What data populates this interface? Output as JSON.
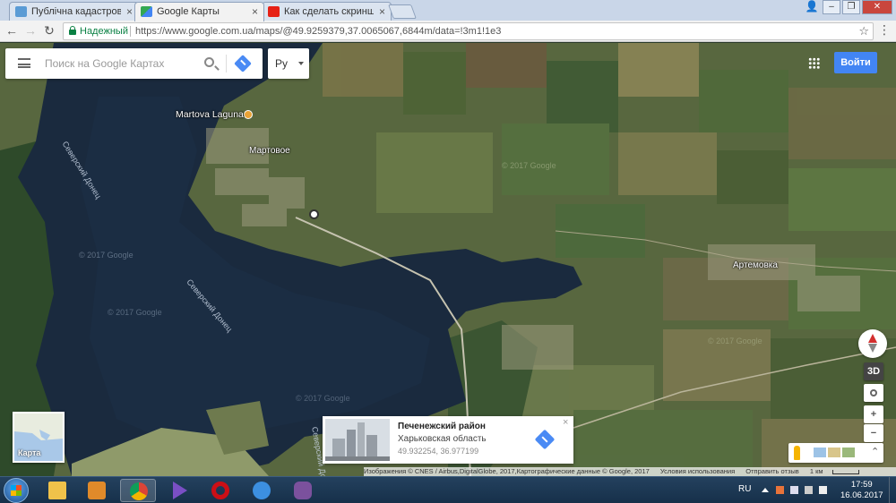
{
  "browser": {
    "tabs": [
      {
        "title": "Публічна кадастрова ка",
        "icon": "cadastre-map-icon",
        "color": "#5a9bd5"
      },
      {
        "title": "Google Карты",
        "icon": "google-maps-icon",
        "color": "#34a853",
        "active": true
      },
      {
        "title": "Как сделать скриншот н",
        "icon": "youtube-icon",
        "color": "#e62117"
      }
    ],
    "secure_label": "Надежный",
    "url": "https://www.google.com.ua/maps/@49.9259379,37.0065067,6844m/data=!3m1!1e3"
  },
  "maps": {
    "search_placeholder": "Поиск на Google Картах",
    "language": "Ру",
    "signin_label": "Войти",
    "labels": {
      "poi": "Martova Laguna",
      "village1": "Мартовое",
      "village2": "Артемовка",
      "river1": "Северский Донец",
      "river2": "Северский Донец",
      "river3": "Северский Донец"
    },
    "watermarks": [
      "© 2017 Google",
      "© 2017 Google",
      "© 2017 Google",
      "© 2017 Google",
      "© 2017 Google"
    ],
    "controls": {
      "tilt": "3D",
      "zoom_in": "+",
      "zoom_out": "−",
      "expand": "⌃"
    },
    "info_card": {
      "title": "Печенежский район",
      "subtitle": "Харьковская область",
      "coords": "49.932254, 36.977199",
      "close": "×"
    },
    "minimap_label": "Карта",
    "attribution": {
      "imagery": "Изображения © CNES / Airbus,DigitalGlobe, 2017,Картографические данные © Google, 2017",
      "terms": "Условия использования",
      "feedback": "Отправить отзыв",
      "scale": "1 км"
    }
  },
  "taskbar": {
    "apps": [
      {
        "name": "explorer",
        "icon": "folder-icon",
        "color": "#f0c24a"
      },
      {
        "name": "media",
        "icon": "media-player-icon",
        "color": "#e08a2a"
      },
      {
        "name": "chrome",
        "icon": "chrome-icon",
        "color": "#db4437",
        "active": true
      },
      {
        "name": "video",
        "icon": "play-icon",
        "color": "#6b3fa0"
      },
      {
        "name": "opera",
        "icon": "opera-icon",
        "color": "#cc0f16"
      },
      {
        "name": "ie",
        "icon": "internet-explorer-icon",
        "color": "#3c8fe0"
      },
      {
        "name": "viber",
        "icon": "viber-icon",
        "color": "#7b519d"
      }
    ],
    "lang": "RU",
    "time": "17:59",
    "date": "16.06.2017"
  }
}
